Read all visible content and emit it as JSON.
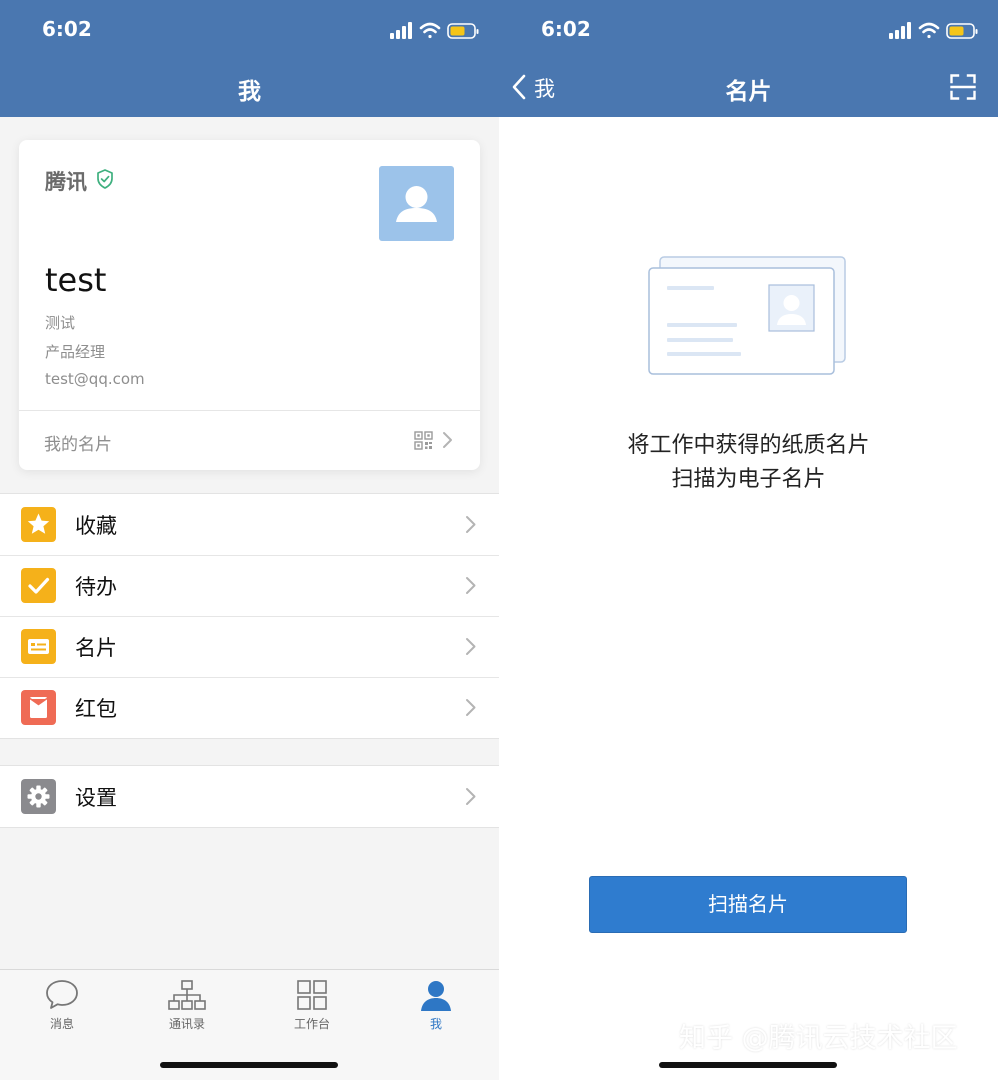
{
  "left": {
    "status": {
      "time": "6:02"
    },
    "nav": {
      "title": "我"
    },
    "card": {
      "company": "腾讯",
      "name": "test",
      "department": "测试",
      "position": "产品经理",
      "email": "test@qq.com",
      "footer_label": "我的名片"
    },
    "menu": {
      "favorites": "收藏",
      "todo": "待办",
      "cards": "名片",
      "red_packet": "红包",
      "settings": "设置"
    },
    "tabs": {
      "messages": "消息",
      "contacts": "通讯录",
      "workbench": "工作台",
      "me": "我"
    }
  },
  "right": {
    "status": {
      "time": "6:02"
    },
    "nav": {
      "title": "名片",
      "back_label": "我"
    },
    "intro_line1": "将工作中获得的纸质名片",
    "intro_line2": "扫描为电子名片",
    "scan_button": "扫描名片",
    "watermark": "知乎 @腾讯云技术社区"
  },
  "colors": {
    "nav_bar": "#4a77b0",
    "primary_button": "#2f7ccf",
    "favorites_icon": "#f5b11a",
    "todo_icon": "#f5b11a",
    "cards_icon": "#f5b11a",
    "red_packet_icon": "#ef6b55",
    "settings_icon": "#8a8a8e",
    "active_tab": "#2e77c5",
    "verified": "#3fb07f"
  },
  "icons": {
    "status": [
      "cellular-signal-icon",
      "wifi-icon",
      "battery-icon"
    ],
    "card": [
      "verified-shield-icon",
      "avatar-placeholder",
      "qr-code-icon",
      "chevron-right-icon"
    ],
    "menu": [
      "star-icon",
      "checkmark-icon",
      "business-card-icon",
      "red-envelope-icon",
      "gear-icon"
    ],
    "tabs": [
      "chat-bubble-icon",
      "org-chart-icon",
      "grid-icon",
      "person-icon"
    ],
    "right": [
      "back-chevron-icon",
      "scan-frame-icon",
      "business-card-illustration"
    ]
  }
}
